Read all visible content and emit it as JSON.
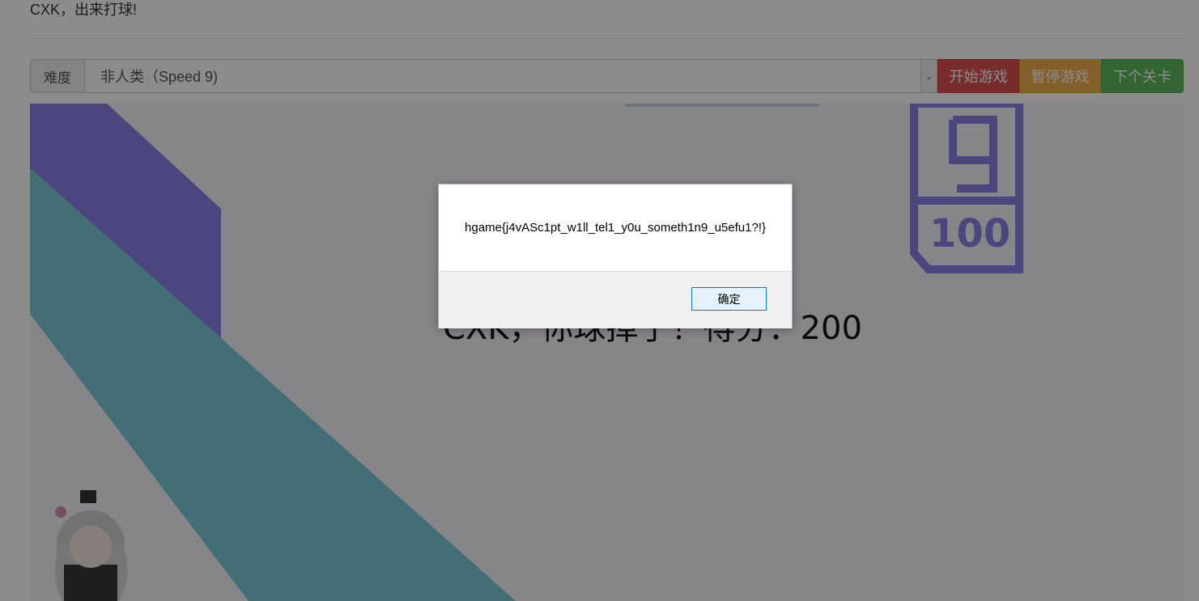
{
  "page": {
    "heading": "CXK，出来打球!"
  },
  "controls": {
    "difficulty_label": "难度",
    "difficulty_selected": "非人类（Speed 9)",
    "start_label": "开始游戏",
    "pause_label": "暂停游戏",
    "next_label": "下个关卡"
  },
  "game": {
    "score_message": "CXK，你球掉了！得分：200",
    "badge_number": "100"
  },
  "dialog": {
    "message": "hgame{j4vASc1pt_w1ll_tel1_y0u_someth1n9_u5efu1?!}",
    "ok_label": "确定"
  },
  "colors": {
    "start": "#d9534f",
    "pause": "#f0ad4e",
    "next": "#5cb85c",
    "stripe_purple": "#8a80e8",
    "stripe_teal": "#7cc9d6"
  }
}
